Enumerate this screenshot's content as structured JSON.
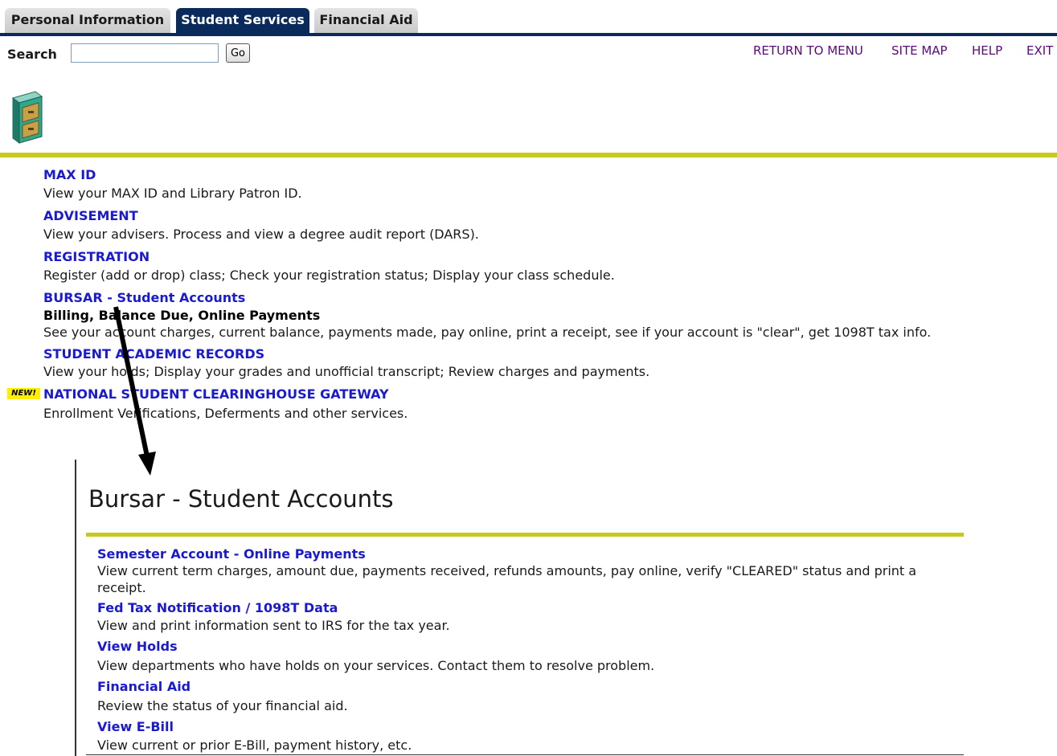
{
  "tabs": [
    {
      "label": "Personal Information",
      "active": false
    },
    {
      "label": "Student Services",
      "active": true
    },
    {
      "label": "Financial Aid",
      "active": false
    }
  ],
  "search": {
    "label": "Search",
    "value": "",
    "go_label": "Go"
  },
  "top_links": [
    "RETURN TO MENU",
    "SITE MAP",
    "HELP",
    "EXIT"
  ],
  "menu": {
    "max_id": {
      "title": "MAX ID",
      "desc": "View your MAX ID and Library Patron ID."
    },
    "advisement": {
      "title": "ADVISEMENT",
      "desc": "View your advisers. Process and view a degree audit report (DARS)."
    },
    "registration": {
      "title": "REGISTRATION",
      "desc": "Register (add or drop) class; Check your registration status; Display your class schedule."
    },
    "bursar": {
      "title": "BURSAR - Student Accounts",
      "subtitle": "Billing, Balance Due, Online Payments",
      "desc": "See your account charges, current balance, payments made, pay online, print a receipt, see if your account is \"clear\", get 1098T tax info."
    },
    "records": {
      "title": "STUDENT ACADEMIC RECORDS",
      "desc": "View your holds; Display your grades and unofficial transcript; Review charges and payments."
    },
    "clearinghouse": {
      "badge": "NEW!",
      "title": "NATIONAL STUDENT CLEARINGHOUSE GATEWAY",
      "desc": "Enrollment Verifications, Deferments and other services."
    }
  },
  "bursar_panel": {
    "title": "Bursar - Student Accounts",
    "items": [
      {
        "title": "Semester Account - Online Payments",
        "desc": "View current term charges, amount due, payments received, refunds amounts, pay online, verify \"CLEARED\" status and print a receipt."
      },
      {
        "title": "Fed Tax Notification / 1098T Data",
        "desc": "View and print information sent to IRS for the tax year."
      },
      {
        "title": "View Holds",
        "desc": "View departments who have holds on your services. Contact them to resolve problem."
      },
      {
        "title": "Financial Aid",
        "desc": "Review the status of your financial aid."
      },
      {
        "title": "View E-Bill",
        "desc": "View current or prior E-Bill, payment history, etc."
      }
    ]
  },
  "colors": {
    "tab_active": "#0b2a5c",
    "link": "#1a1ad0",
    "top_link": "#5a0a7a",
    "rule": "#c8c81e",
    "new_badge": "#ffee00"
  },
  "icons": [
    "file-cabinet-icon",
    "annotation-arrow"
  ]
}
